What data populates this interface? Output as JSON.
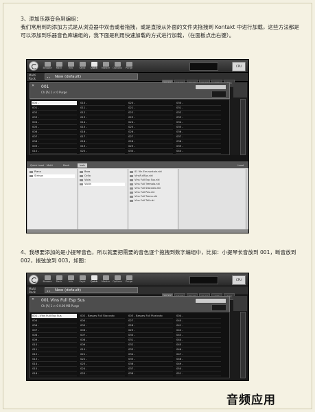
{
  "step3": {
    "title": "3、添加乐器音色到编组：",
    "body": "我们常用到的添加方式是从浏览器中双击或者拖拽，或是直接从外面的文件夹拖拽到 Kontakt 中进行加载，这些方法都是可以添加到乐器音色库编组的，我下面是利用快速加载的方式进行加载，（在面板点击右键）。"
  },
  "step4": {
    "body": "4、我想要添加的是小提琴音色，所以就要把需要的音色逐个拖拽到数字编组中，比如：小提琴长音放到 001，断音放到 002，拨弦放到 003，如图："
  },
  "toolbar": {
    "buttons": [
      "Browse",
      "Rack",
      "Info",
      "Keyb",
      "Quick",
      "Master",
      "Options",
      "Purge"
    ],
    "active": "Quick",
    "cpu_label": "CPU"
  },
  "rack": {
    "multi_label_1": "Multi",
    "multi_label_2": "Rack",
    "name": "New (default)",
    "tabs": [
      "01-16",
      "17-32",
      "33-48",
      "49-64",
      "KSP",
      "AUX"
    ]
  },
  "shot1": {
    "instrument_name": "001",
    "instrument_sub": "Ch [A] 1   v: 0   Purge",
    "grid_cols": [
      [
        "000 -",
        "001 -",
        "002 -",
        "003 -",
        "004 -",
        "005 -",
        "006 -",
        "007 -",
        "008 -",
        "009 -",
        "010 -"
      ],
      [
        "010 -",
        "011 -",
        "012 -",
        "013 -",
        "014 -",
        "015 -",
        "016 -",
        "017 -",
        "018 -",
        "019 -",
        "020 -"
      ],
      [
        "020 -",
        "021 -",
        "022 -",
        "023 -",
        "024 -",
        "025 -",
        "026 -",
        "027 -",
        "028 -",
        "029 -",
        "030 -"
      ],
      [
        "030 -",
        "031 -",
        "032 -",
        "033 -",
        "034 -",
        "035 -",
        "036 -",
        "037 -",
        "038 -",
        "039 -",
        "040 -"
      ]
    ],
    "browser_tabs": [
      "Quick Load",
      "Multi",
      "Bank",
      "Instr"
    ],
    "browser_active": "Instr",
    "col1": [
      "Piano",
      "Strings"
    ],
    "col2": [
      "Bass",
      "Cello",
      "Viola",
      "Violin"
    ],
    "col3": [
      "01 Vln Ens sustain.nki",
      "VinsFullSus.nki",
      "Vlns Full Esp Sus.nki",
      "Vlns Full Tremolo.nki",
      "Vlns Full Staccato.nki",
      "Vlns Full Pizz.nki",
      "Vlns Full Trems.nki",
      "Vlns Full Trill.nki"
    ],
    "browser_close": "Load"
  },
  "shot2": {
    "instrument_name": "001   Vlns Full Esp Sus",
    "instrument_sub": "Ch [A] 1   v: 0   0.00 MB   Purge",
    "grid_cols": [
      [
        "001 - Vlns Full Esp Sus",
        "004 -",
        "006 -",
        "007 -",
        "008 -",
        "009 -",
        "010 -",
        "011 -",
        "012 -",
        "013 -",
        "014 -",
        "015 -",
        "016 -"
      ],
      [
        "002 - Basses Full Stoccato",
        "004 -",
        "005 -",
        "006 -",
        "007 -",
        "008 -",
        "009 -",
        "010 -",
        "021 -",
        "022 -",
        "023 -",
        "024 -",
        "025 -"
      ],
      [
        "003 - Basses Full Pizzicato",
        "027 -",
        "028 -",
        "029 -",
        "030 -",
        "031 -",
        "032 -",
        "033 -",
        "034 -",
        "035 -",
        "036 -",
        "037 -",
        "038 -"
      ],
      [
        "004 -",
        "040 -",
        "041 -",
        "042 -",
        "043 -",
        "044 -",
        "045 -",
        "046 -",
        "047 -",
        "048 -",
        "049 -",
        "050 -",
        "051 -"
      ]
    ]
  },
  "brand": "音频应用"
}
